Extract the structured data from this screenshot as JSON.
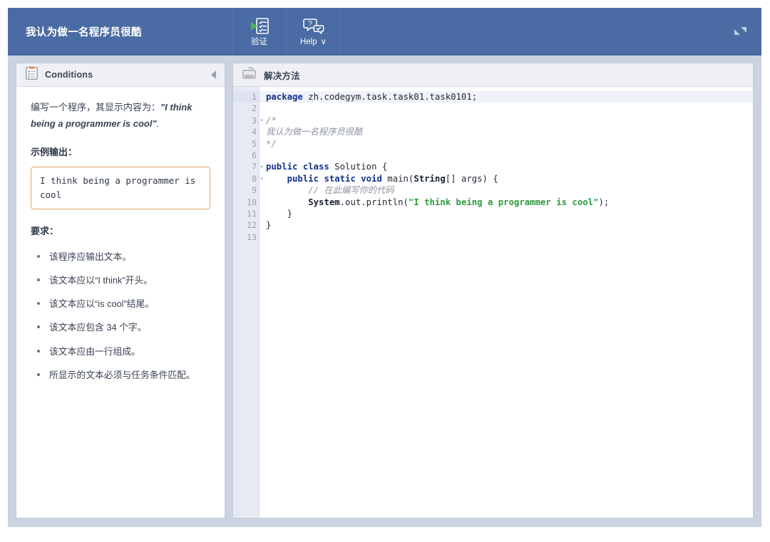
{
  "toolbar": {
    "task_title": "我认为做一名程序员很酷",
    "verify": {
      "label": "验证",
      "icon": "checklist-play-icon"
    },
    "help": {
      "label": "Help",
      "caret": "∨",
      "icon": "help-bubble-icon"
    },
    "collapse": {
      "icon": "collapse-diagonal-icon"
    },
    "background_color": "#4a6ba3"
  },
  "conditions": {
    "icon": "clipboard-icon",
    "title": "Conditions",
    "collapse_icon": "triangle-left-icon",
    "intro_prefix": "编写一个程序，其显示内容为：",
    "intro_emphasis": "\"I think being a programmer is cool\"",
    "intro_suffix": ".",
    "sample_label": "示例输出：",
    "sample_output": "I think being a programmer is cool",
    "sample_border_color": "#e3a960",
    "requirements_title": "要求：",
    "requirements": [
      "该程序应输出文本。",
      "该文本应以“I think”开头。",
      "该文本应以“is cool”结尾。",
      "该文本应包含 34 个字。",
      "该文本应由一行组成。",
      "所显示的文本必须与任务条件匹配。"
    ]
  },
  "solution": {
    "icon": "keyboard-icon",
    "title": "解决方法",
    "line_numbers": [
      1,
      2,
      3,
      4,
      5,
      6,
      7,
      8,
      9,
      10,
      11,
      12,
      13
    ],
    "fold_lines": [
      3,
      7,
      8
    ],
    "active_line": 1,
    "code_lines": [
      {
        "n": 1,
        "tokens": [
          {
            "t": "kw",
            "s": "package"
          },
          {
            "t": "pln",
            "s": " zh.codegym.task.task01.task0101;"
          }
        ]
      },
      {
        "n": 2,
        "tokens": []
      },
      {
        "n": 3,
        "tokens": [
          {
            "t": "cmt",
            "s": "/*"
          }
        ]
      },
      {
        "n": 4,
        "tokens": [
          {
            "t": "cmt",
            "s": "我认为做一名程序员很酷"
          }
        ]
      },
      {
        "n": 5,
        "tokens": [
          {
            "t": "cmt",
            "s": "*/"
          }
        ]
      },
      {
        "n": 6,
        "tokens": []
      },
      {
        "n": 7,
        "tokens": [
          {
            "t": "kw",
            "s": "public class"
          },
          {
            "t": "pln",
            "s": " Solution {"
          }
        ]
      },
      {
        "n": 8,
        "tokens": [
          {
            "t": "pln",
            "s": "    "
          },
          {
            "t": "kw",
            "s": "public static void"
          },
          {
            "t": "pln",
            "s": " main("
          },
          {
            "t": "typ",
            "s": "String"
          },
          {
            "t": "pln",
            "s": "[] args) {"
          }
        ]
      },
      {
        "n": 9,
        "tokens": [
          {
            "t": "pln",
            "s": "        "
          },
          {
            "t": "cmt",
            "s": "// 在此编写你的代码"
          }
        ]
      },
      {
        "n": 10,
        "tokens": [
          {
            "t": "pln",
            "s": "        "
          },
          {
            "t": "typ",
            "s": "System"
          },
          {
            "t": "pln",
            "s": ".out.println("
          },
          {
            "t": "str",
            "s": "\"I think being a programmer is cool\""
          },
          {
            "t": "pln",
            "s": ");"
          }
        ]
      },
      {
        "n": 11,
        "tokens": [
          {
            "t": "pln",
            "s": "    }"
          }
        ]
      },
      {
        "n": 12,
        "tokens": [
          {
            "t": "pln",
            "s": "}"
          }
        ]
      },
      {
        "n": 13,
        "tokens": []
      }
    ],
    "colors": {
      "keyword": "#16308f",
      "string": "#2f9a3e",
      "comment": "#8d949f",
      "plain": "#242a33",
      "gutter_bg": "#e7eaf3"
    }
  }
}
